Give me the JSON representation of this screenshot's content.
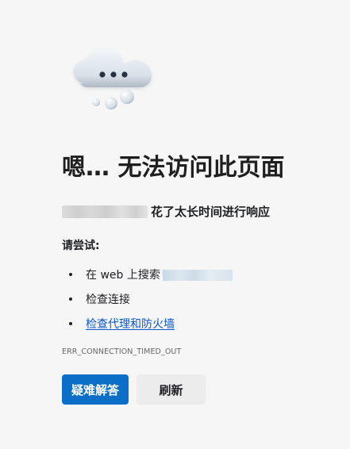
{
  "illustration": {
    "icon": "cloud-ellipsis-icon",
    "colors": {
      "cloud_light": "#f2f5f8",
      "cloud_shadow": "#aab5c1",
      "dots": "#283544"
    }
  },
  "error_page": {
    "title": "嗯… 无法访问此页面",
    "subtitle": "花了太长时间进行响应",
    "suggestions_heading": "请尝试:",
    "suggestions": [
      {
        "prefix": "在 web 上搜索"
      },
      {
        "label": "检查连接"
      },
      {
        "link_text": "检查代理和防火墙"
      }
    ],
    "error_code": "ERR_CONNECTION_TIMED_OUT"
  },
  "buttons": {
    "troubleshoot": "疑难解答",
    "refresh": "刷新"
  },
  "colors": {
    "background": "#f6f6f6",
    "primary": "#0b6fc8",
    "link": "#0b57d0"
  }
}
